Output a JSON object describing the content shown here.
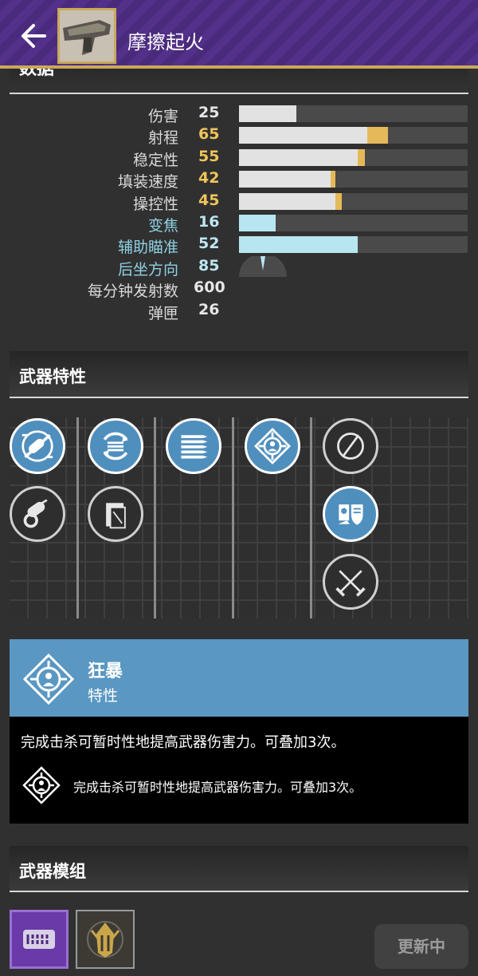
{
  "header": {
    "title": "摩擦起火",
    "back_icon": "arrow-left-icon",
    "thumbnail_icon": "weapon-thumbnail",
    "background_color": "#4a2a7c",
    "accent_color": "#c9a95a"
  },
  "stats_section": {
    "title": "数据",
    "stats": [
      {
        "label": "伤害",
        "value": "25",
        "base": 25,
        "bonus": 0,
        "style": "normal"
      },
      {
        "label": "射程",
        "value": "65",
        "base": 56,
        "bonus": 9,
        "style": "gold"
      },
      {
        "label": "稳定性",
        "value": "55",
        "base": 52,
        "bonus": 3,
        "style": "gold"
      },
      {
        "label": "填装速度",
        "value": "42",
        "base": 40,
        "bonus": 2,
        "style": "gold"
      },
      {
        "label": "操控性",
        "value": "45",
        "base": 42,
        "bonus": 3,
        "style": "gold"
      },
      {
        "label": "变焦",
        "value": "16",
        "base": 16,
        "bonus": 0,
        "style": "cyan"
      },
      {
        "label": "辅助瞄准",
        "value": "52",
        "base": 52,
        "bonus": 0,
        "style": "cyan"
      },
      {
        "label": "后坐方向",
        "value": "85",
        "style": "cyan",
        "display": "recoil-gauge"
      },
      {
        "label": "每分钟发射数",
        "value": "600",
        "style": "normal",
        "display": "none"
      },
      {
        "label": "弹匣",
        "value": "26",
        "style": "normal",
        "display": "none"
      }
    ]
  },
  "traits_section": {
    "title": "武器特性",
    "perks": [
      {
        "icon": "barrel-icon",
        "selected": true
      },
      {
        "icon": "barrel-attachment-icon",
        "selected": false
      },
      {
        "icon": "magazine-cycle-icon",
        "selected": true
      },
      {
        "icon": "magazine-card-icon",
        "selected": false
      },
      {
        "icon": "rounds-icon",
        "selected": true
      },
      {
        "icon": "rampage-icon",
        "selected": true
      },
      {
        "icon": "empty-slot-icon",
        "selected": false
      },
      {
        "icon": "shader-icon",
        "selected": true
      },
      {
        "icon": "crossed-swords-icon",
        "selected": false
      }
    ]
  },
  "selected_perk": {
    "name": "狂暴",
    "type": "特性",
    "description": "完成击杀可暂时性地提高武器伤害力。可叠加3次。",
    "sub_description": "完成击杀可暂时性地提高武器伤害力。可叠加3次。",
    "icon": "rampage-icon",
    "header_color": "#5a97c2"
  },
  "mods_section": {
    "title": "武器模组",
    "mods": [
      {
        "icon": "mod-ammo-icon"
      },
      {
        "icon": "mod-ornament-icon"
      }
    ],
    "update_button": "更新中"
  }
}
